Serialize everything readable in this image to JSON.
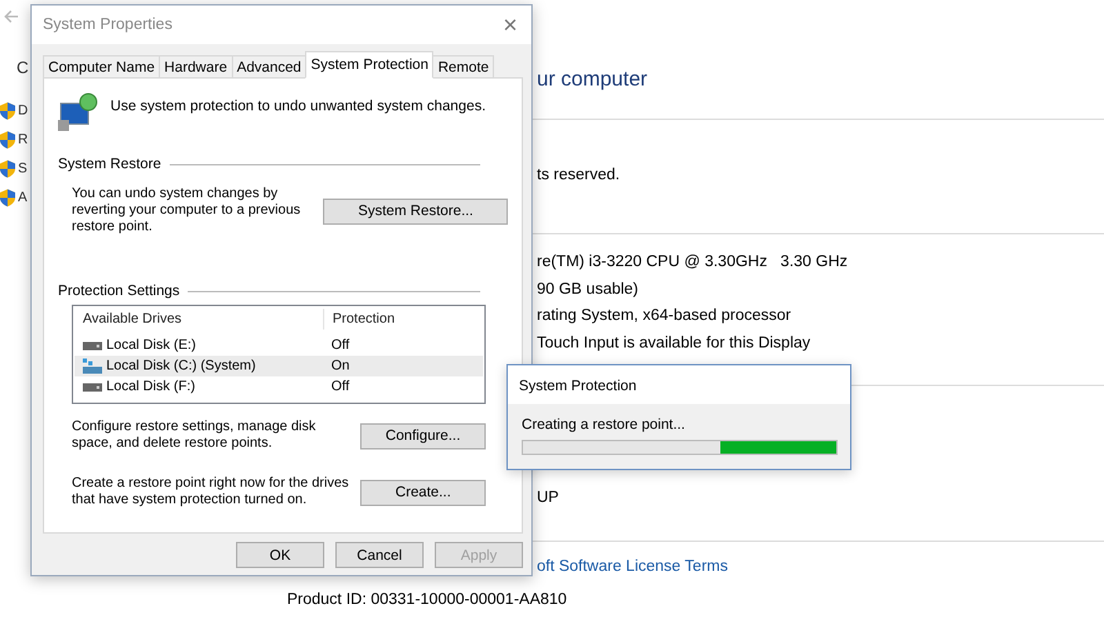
{
  "background": {
    "nav_letter": "C",
    "tasks": [
      "D",
      "R",
      "S",
      "A"
    ],
    "heading": "ur computer",
    "sections": [
      [
        "ts reserved."
      ],
      [
        "re(TM) i3-3220 CPU @ 3.30GHz   3.30 GHz",
        "90 GB usable)",
        "rating System, x64-based processor",
        "Touch Input is available for this Display"
      ],
      [
        "UP"
      ]
    ],
    "license_link": "oft Software License Terms",
    "product_id": "Product ID: 00331-10000-00001-AA810"
  },
  "dialog": {
    "title": "System Properties",
    "close": "×",
    "tabs": [
      {
        "label": "Computer Name",
        "selected": false
      },
      {
        "label": "Hardware",
        "selected": false
      },
      {
        "label": "Advanced",
        "selected": false
      },
      {
        "label": "System Protection",
        "selected": true
      },
      {
        "label": "Remote",
        "selected": false
      }
    ],
    "intro": "Use system protection to undo unwanted system changes.",
    "system_restore": {
      "legend": "System Restore",
      "text": "You can undo system changes by reverting your computer to a previous restore point.",
      "button": "System Restore..."
    },
    "protection": {
      "legend": "Protection Settings",
      "columns": [
        "Available Drives",
        "Protection"
      ],
      "drives": [
        {
          "name": "Local Disk (E:)",
          "protection": "Off",
          "kind": "disk",
          "selected": false
        },
        {
          "name": "Local Disk (C:) (System)",
          "protection": "On",
          "kind": "system",
          "selected": true
        },
        {
          "name": "Local Disk (F:)",
          "protection": "Off",
          "kind": "disk",
          "selected": false
        }
      ],
      "configure": {
        "text": "Configure restore settings, manage disk space, and delete restore points.",
        "button": "Configure..."
      },
      "create": {
        "text": "Create a restore point right now for the drives that have system protection turned on.",
        "button": "Create..."
      }
    },
    "buttons": [
      {
        "label": "OK",
        "disabled": false
      },
      {
        "label": "Cancel",
        "disabled": false
      },
      {
        "label": "Apply",
        "disabled": true
      }
    ]
  },
  "progress": {
    "title": "System Protection",
    "message": "Creating a restore point...",
    "level": 0.37
  }
}
